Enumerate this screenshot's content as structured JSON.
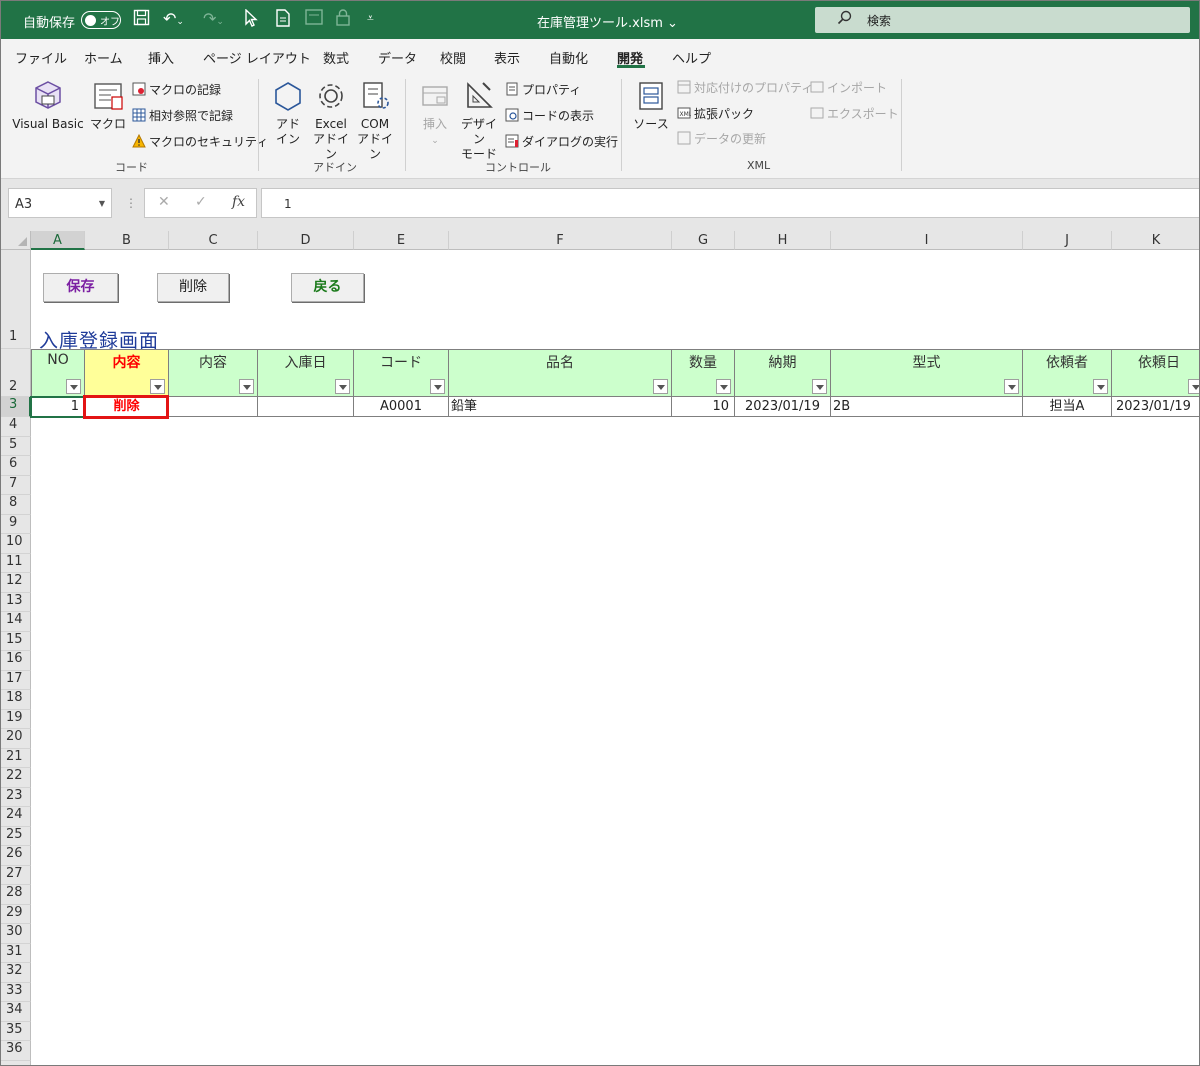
{
  "titlebar": {
    "autosave_label": "自動保存",
    "autosave_state": "オフ",
    "filename": "在庫管理ツール.xlsm",
    "search_placeholder": "検索",
    "bg_color": "#217346"
  },
  "ribbon": {
    "tabs": [
      "ファイル",
      "ホーム",
      "挿入",
      "ページ レイアウト",
      "数式",
      "データ",
      "校閲",
      "表示",
      "自動化",
      "開発",
      "ヘルプ"
    ],
    "active_tab": "開発",
    "code": {
      "visual_basic": "Visual Basic",
      "macro": "マクロ",
      "record_macro": "マクロの記録",
      "relative_ref": "相対参照で記録",
      "macro_security": "マクロのセキュリティ",
      "group_label": "コード"
    },
    "addins": {
      "addin_1": "アド",
      "addin_2": "イン",
      "excel_1": "Excel",
      "excel_2": "アドイン",
      "com_1": "COM",
      "com_2": "アドイン",
      "group_label": "アドイン"
    },
    "controls": {
      "insert": "挿入",
      "design_1": "デザイン",
      "design_2": "モード",
      "properties": "プロパティ",
      "view_code": "コードの表示",
      "run_dialog": "ダイアログの実行",
      "group_label": "コントロール"
    },
    "xml": {
      "source": "ソース",
      "map_properties": "対応付けのプロパティ",
      "expansion_packs": "拡張パック",
      "refresh_data": "データの更新",
      "import": "インポート",
      "export": "エクスポート",
      "group_label": "XML"
    }
  },
  "formula_bar": {
    "name_box": "A3",
    "formula": "1"
  },
  "sheet": {
    "columns": [
      "A",
      "B",
      "C",
      "D",
      "E",
      "F",
      "G",
      "H",
      "I",
      "J",
      "K"
    ],
    "selected_column": "A",
    "rows": [
      "1",
      "2",
      "3",
      "4",
      "5",
      "6",
      "7",
      "8",
      "9",
      "10",
      "11",
      "12",
      "13",
      "14",
      "15",
      "16",
      "17",
      "18",
      "19",
      "20",
      "21",
      "22",
      "23",
      "24",
      "25",
      "26",
      "27",
      "28",
      "29",
      "30",
      "31",
      "32",
      "33",
      "34",
      "35",
      "36"
    ],
    "selected_row": "3",
    "buttons": {
      "save": "保存",
      "delete": "削除",
      "back": "戻る"
    },
    "title": "入庫登録画面",
    "headers": [
      "NO",
      "内容",
      "内容",
      "入庫日",
      "コード",
      "品名",
      "数量",
      "納期",
      "型式",
      "依頼者",
      "依頼日"
    ],
    "record": {
      "no": "1",
      "action": "削除",
      "content": "",
      "date_in": "",
      "code": "A0001",
      "item": "鉛筆",
      "qty": "10",
      "due": "2023/01/19",
      "model": "2B",
      "requester": "担当A",
      "request_date": "2023/01/19"
    },
    "colors": {
      "header_green": "#ccffcc",
      "header_yellow": "#ffff99",
      "highlight_red": "#e31414",
      "title_blue": "#1f3b99"
    }
  }
}
